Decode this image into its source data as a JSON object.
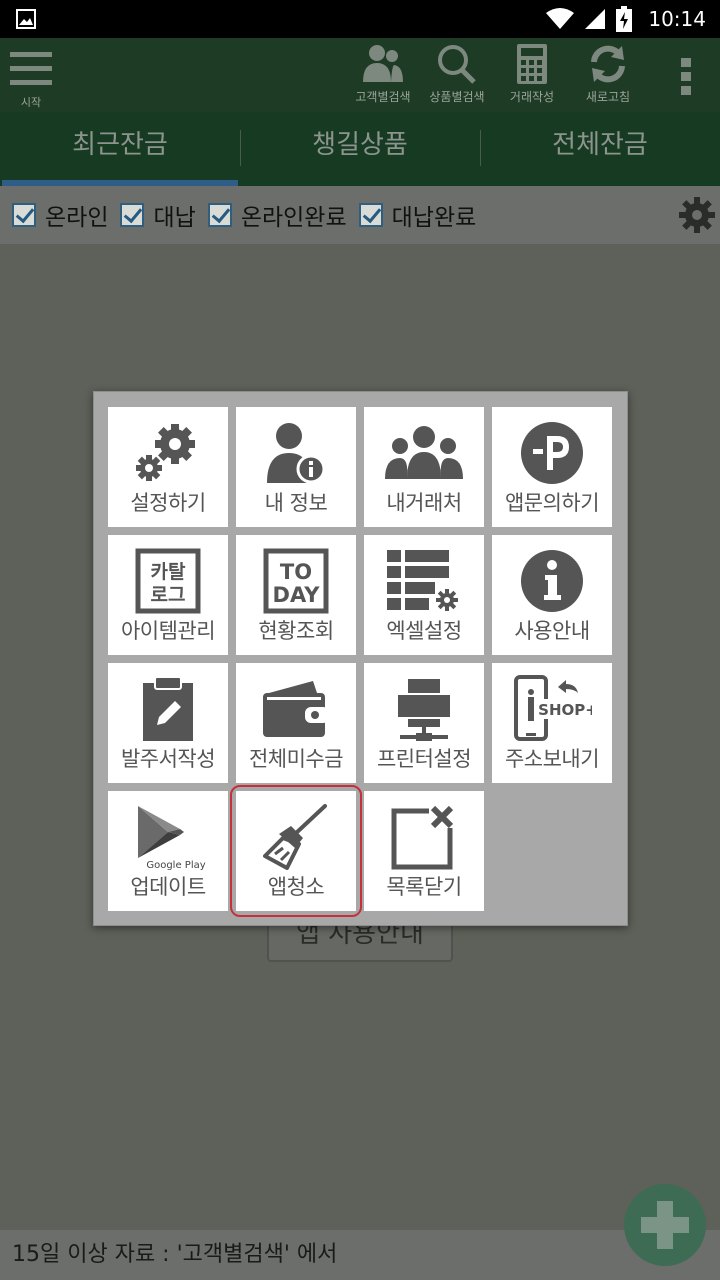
{
  "status_bar": {
    "time": "10:14"
  },
  "app_bar": {
    "menu_label": "시작",
    "tools": [
      {
        "icon": "people-icon",
        "label": "고객별검색"
      },
      {
        "icon": "search-icon",
        "label": "상품별검색"
      },
      {
        "icon": "calculator-icon",
        "label": "거래작성"
      },
      {
        "icon": "refresh-icon",
        "label": "새로고침"
      }
    ]
  },
  "tabs": [
    {
      "label": "최근잔금",
      "active": true
    },
    {
      "label": "챙길상품",
      "active": false
    },
    {
      "label": "전체잔금",
      "active": false
    }
  ],
  "filters": [
    {
      "label": "온라인",
      "checked": true
    },
    {
      "label": "대납",
      "checked": true
    },
    {
      "label": "온라인완료",
      "checked": true
    },
    {
      "label": "대납완료",
      "checked": true
    }
  ],
  "under_button": {
    "label": "앱 사용안내"
  },
  "footer": {
    "text": "15일 이상 자료 : '고객별검색' 에서"
  },
  "menu": {
    "items": [
      {
        "label": "설정하기",
        "icon": "settings-gears-icon"
      },
      {
        "label": "내 정보",
        "icon": "user-info-icon"
      },
      {
        "label": "내거래처",
        "icon": "clients-group-icon"
      },
      {
        "label": "앱문의하기",
        "icon": "app-inquiry-p-icon"
      },
      {
        "label": "아이템관리",
        "icon": "catalog-icon"
      },
      {
        "label": "현황조회",
        "icon": "today-icon"
      },
      {
        "label": "엑셀설정",
        "icon": "excel-table-icon"
      },
      {
        "label": "사용안내",
        "icon": "info-icon"
      },
      {
        "label": "발주서작성",
        "icon": "clipboard-edit-icon"
      },
      {
        "label": "전체미수금",
        "icon": "wallet-icon"
      },
      {
        "label": "프린터설정",
        "icon": "printer-icon"
      },
      {
        "label": "주소보내기",
        "icon": "shop-share-icon"
      },
      {
        "label": "업데이트",
        "icon": "google-play-icon"
      },
      {
        "label": "앱청소",
        "icon": "broom-icon",
        "highlighted": true
      },
      {
        "label": "목록닫기",
        "icon": "close-window-icon"
      }
    ],
    "icon_text": {
      "catalog": [
        "카탈",
        "로그"
      ],
      "today": [
        "TO",
        "DAY"
      ],
      "google_play": "Google Play",
      "shop": "SHOP+"
    }
  },
  "colors": {
    "dialog_bg": "#a8a8a8",
    "icon_gray": "#555555",
    "highlight_red": "#c5303c",
    "check_blue": "#255a82"
  }
}
